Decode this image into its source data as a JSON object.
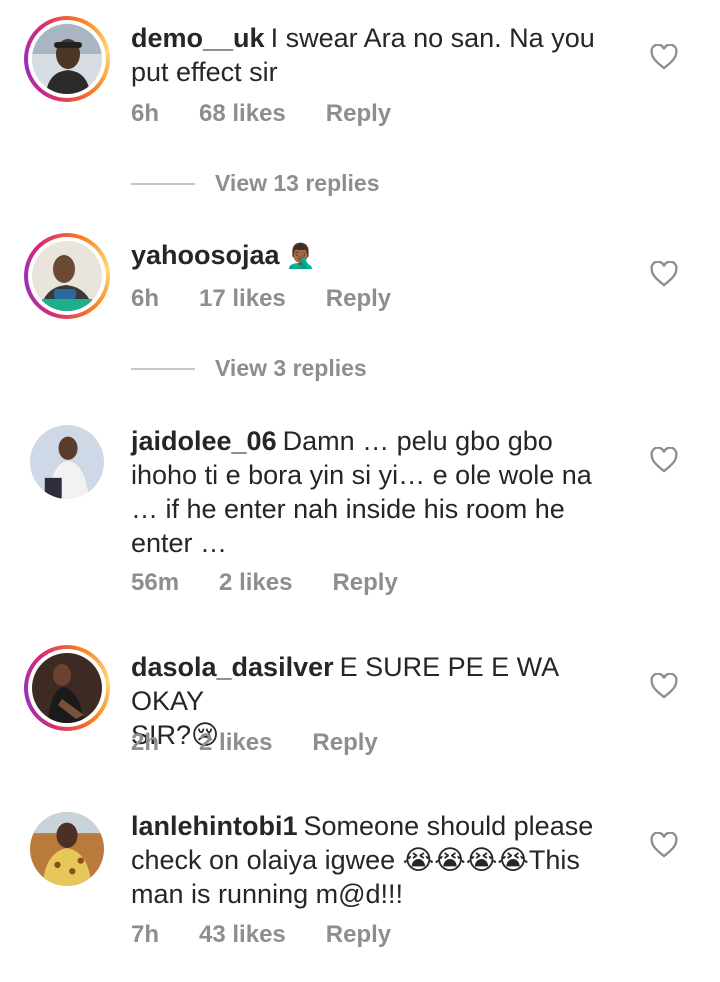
{
  "comments": [
    {
      "username": "demo__uk",
      "text": "I swear Ara no san. Na you put effect sir",
      "line1": "I swear Ara no san. Na you",
      "line2": "put effect sir",
      "time": "6h",
      "likes": "68 likes",
      "reply": "Reply",
      "view_replies": "View 13 replies",
      "has_story": true
    },
    {
      "username": "yahoosojaa",
      "text": "🤦🏾‍♂️",
      "time": "6h",
      "likes": "17 likes",
      "reply": "Reply",
      "view_replies": "View 3 replies",
      "has_story": true
    },
    {
      "username": "jaidolee_06",
      "line1": "Damn … pelu gbo gbo",
      "line2": "ihoho ti e bora yin si yi…  e ole wole na",
      "line3": "… if he enter nah inside his room he",
      "line4": "enter …",
      "time": "56m",
      "likes": "2 likes",
      "reply": "Reply",
      "has_story": false
    },
    {
      "username": "dasola_dasilver",
      "line1": "E SURE PE E WA OKAY",
      "line2": "SIR?😢",
      "time": "2h",
      "likes": "2 likes",
      "reply": "Reply",
      "has_story": true
    },
    {
      "username": "lanlehintobi1",
      "line1": "Someone should please",
      "line2": "check on olaiya igwee 😭😭😭😭This",
      "line3": "man is running m@d!!!",
      "time": "7h",
      "likes": "43 likes",
      "reply": "Reply",
      "has_story": false
    }
  ],
  "icons": {
    "like": "heart-outline-icon"
  },
  "colors": {
    "text": "#262626",
    "secondary": "#8e8e8e",
    "divider": "#c7c7c7"
  }
}
